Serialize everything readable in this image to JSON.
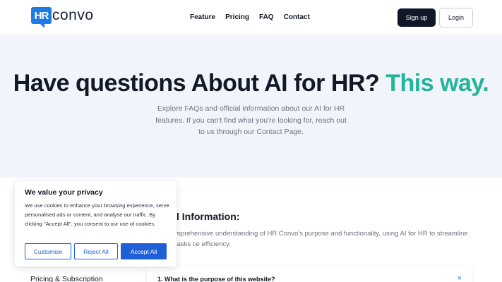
{
  "header": {
    "logo_mark": "HR",
    "logo_word": "convo",
    "nav": [
      "Feature",
      "Pricing",
      "FAQ",
      "Contact"
    ],
    "signup_label": "Sign up",
    "login_label": "Login"
  },
  "hero": {
    "title": "Have questions About AI for HR?",
    "title_accent": "This way.",
    "subtitle": "Explore FAQs and official information about our AI for HR features. If you can't find what you're looking for, reach out to us through our Contact Page."
  },
  "section": {
    "title_visible": "l Information:",
    "description_visible": "mprehensive understanding of HR Convo's purpose and functionality, using AI for HR to streamline tasks ce efficiency."
  },
  "sidebar": {
    "link_label": "Pricing & Subscription"
  },
  "faq": {
    "question": "1. What is the purpose of this website?",
    "close_icon": "×"
  },
  "cookie": {
    "title": "We value your privacy",
    "text": "We use cookies to enhance your browsing experience, serve personalised ads or content, and analyse our traffic. By clicking \"Accept All\", you consent to our use of cookies.",
    "customise_label": "Customise",
    "reject_label": "Reject All",
    "accept_label": "Accept All"
  },
  "colors": {
    "accent_green": "#22b59a",
    "brand_blue": "#1e7be6",
    "cookie_blue": "#1e5fd6",
    "dark": "#101828"
  }
}
